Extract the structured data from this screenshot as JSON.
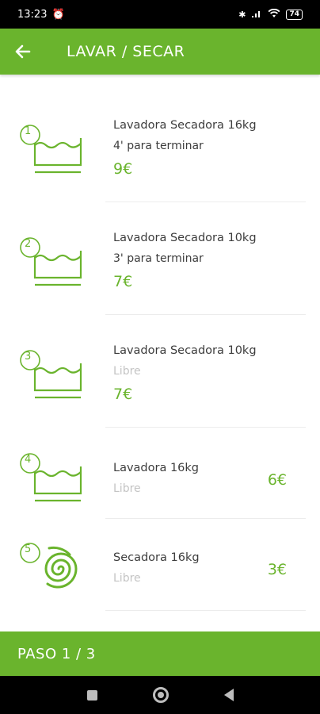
{
  "status_bar": {
    "time": "13:23",
    "battery": "74"
  },
  "header": {
    "title": "LAVAR / SECAR"
  },
  "machines": [
    {
      "number": "1",
      "name": "Lavadora Secadora 16kg",
      "status": "4' para terminar",
      "price": "9€",
      "type": "washer"
    },
    {
      "number": "2",
      "name": "Lavadora Secadora 10kg",
      "status": "3' para terminar",
      "price": "7€",
      "type": "washer"
    },
    {
      "number": "3",
      "name": "Lavadora Secadora 10kg",
      "status": "Libre",
      "price": "7€",
      "type": "washer"
    },
    {
      "number": "4",
      "name": "Lavadora 16kg",
      "status": "Libre",
      "price": "6€",
      "type": "washer"
    },
    {
      "number": "5",
      "name": "Secadora 16kg",
      "status": "Libre",
      "price": "3€",
      "type": "dryer"
    }
  ],
  "footer": {
    "step": "PASO 1 / 3"
  },
  "colors": {
    "accent": "#6ab42d",
    "status_free": "#c4c4c4"
  }
}
